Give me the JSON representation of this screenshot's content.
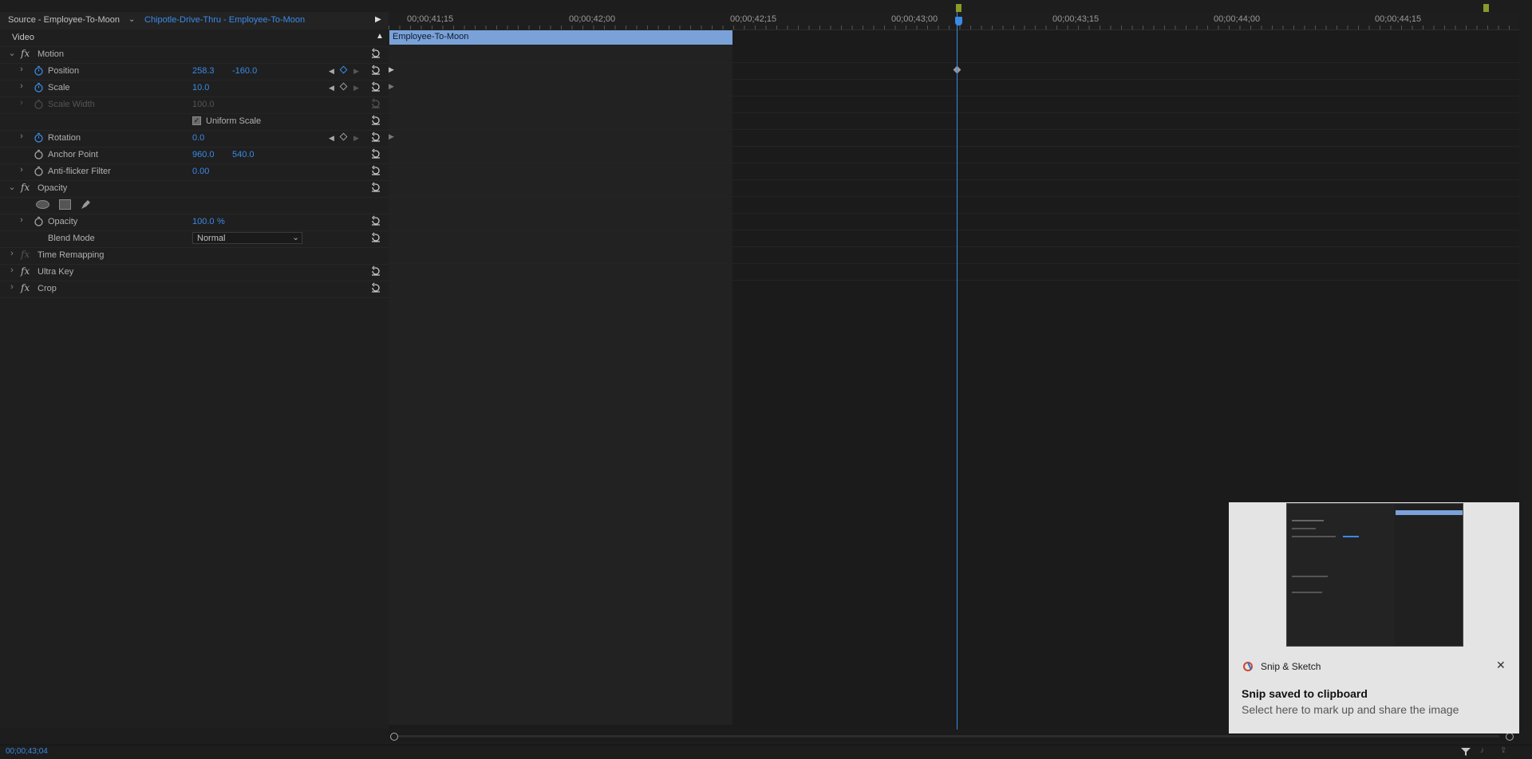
{
  "header": {
    "source_tab": "Source - Employee-To-Moon",
    "sequence_tab": "Chipotle-Drive-Thru - Employee-To-Moon"
  },
  "effects": {
    "section": "Video",
    "motion": {
      "title": "Motion",
      "position": {
        "label": "Position",
        "x": "258.3",
        "y": "-160.0"
      },
      "scale": {
        "label": "Scale",
        "value": "10.0"
      },
      "scale_width": {
        "label": "Scale Width",
        "value": "100.0"
      },
      "uniform_scale": {
        "label": "Uniform Scale",
        "checked": true
      },
      "rotation": {
        "label": "Rotation",
        "value": "0.0"
      },
      "anchor_point": {
        "label": "Anchor Point",
        "x": "960.0",
        "y": "540.0"
      },
      "anti_flicker": {
        "label": "Anti-flicker Filter",
        "value": "0.00"
      }
    },
    "opacity": {
      "title": "Opacity",
      "opacity": {
        "label": "Opacity",
        "value": "100.0",
        "unit": "%"
      },
      "blend_mode": {
        "label": "Blend Mode",
        "value": "Normal"
      }
    },
    "time_remapping": "Time Remapping",
    "ultra_key": "Ultra Key",
    "crop": "Crop"
  },
  "timeline": {
    "timecodes": [
      "00;00;41;15",
      "00;00;42;00",
      "00;00;42;15",
      "00;00;43;00",
      "00;00;43;15",
      "00;00;44;00",
      "00;00;44;15"
    ],
    "clip_name": "Employee-To-Moon"
  },
  "status": {
    "current_time": "00;00;43;04"
  },
  "toast": {
    "app_name": "Snip & Sketch",
    "title": "Snip saved to clipboard",
    "message": "Select here to mark up and share the image"
  },
  "colors": {
    "accent": "#3b8ae6",
    "clip": "#7aa2d8",
    "playhead": "#3b8ae6",
    "marker": "#8a9a2a"
  }
}
